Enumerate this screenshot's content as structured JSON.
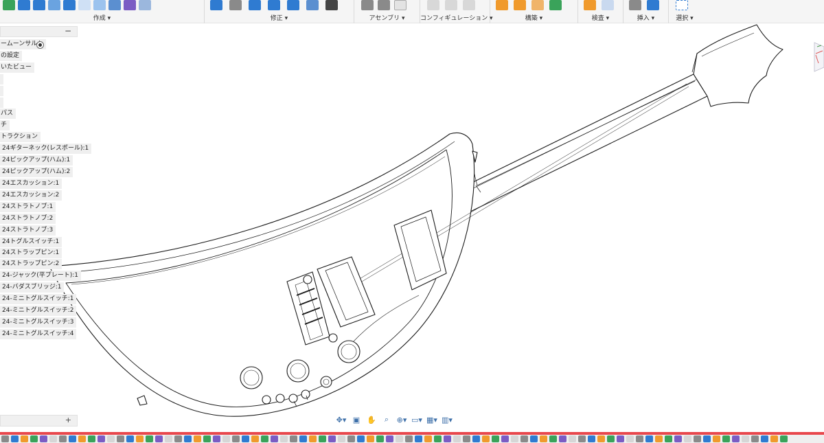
{
  "ribbon": {
    "groups": [
      {
        "label": "作成 ▾",
        "icons": [
          "new-sketch-icon",
          "extrude-icon",
          "box-icon",
          "cylinder-icon",
          "sweep-icon",
          "sketch-line-icon",
          "pattern-icon",
          "cone-icon",
          "add-component-icon",
          "form-icon"
        ]
      },
      {
        "label": "修正 ▾",
        "icons": [
          "press-pull-icon",
          "fillet-icon",
          "shell-icon",
          "combine-icon",
          "split-icon",
          "scale-icon",
          "move-icon"
        ]
      },
      {
        "label": "アセンブリ ▾",
        "icons": [
          "joint-icon",
          "as-built-joint-icon",
          "rigid-group-icon"
        ]
      },
      {
        "label": "コンフィギュレーション ▾",
        "icons": [
          "parameter-table-icon",
          "configure-icon",
          "theme-icon"
        ]
      },
      {
        "label": "構築 ▾",
        "icons": [
          "offset-plane-icon",
          "plane-at-angle-icon",
          "axis-icon",
          "point-icon"
        ]
      },
      {
        "label": "検査 ▾",
        "icons": [
          "measure-icon",
          "section-analysis-icon"
        ]
      },
      {
        "label": "挿入 ▾",
        "icons": [
          "insert-derive-icon",
          "insert-canvas-icon"
        ]
      },
      {
        "label": "選択 ▾",
        "icons": [
          "select-window-icon"
        ]
      }
    ]
  },
  "browser": {
    "items": [
      {
        "label": "ームーンサルト",
        "icon": "radio-icon"
      },
      {
        "label": "の設定"
      },
      {
        "label": "いたビュー"
      },
      {
        "label": ""
      },
      {
        "label": ""
      },
      {
        "label": ""
      },
      {
        "label": "パス"
      },
      {
        "label": "チ"
      },
      {
        "label": "トラクション"
      },
      {
        "label": "24ギターネック(レスポール):1"
      },
      {
        "label": "24ピックアップ(ハム):1"
      },
      {
        "label": "24ピックアップ(ハム):2"
      },
      {
        "label": "24エスカッション:1"
      },
      {
        "label": "24エスカッション:2"
      },
      {
        "label": "24ストラトノブ:1"
      },
      {
        "label": "24ストラトノブ:2"
      },
      {
        "label": "24ストラトノブ:3"
      },
      {
        "label": "24トグルスイッチ:1"
      },
      {
        "label": "24ストラップピン:1"
      },
      {
        "label": "24ストラップピン:2"
      },
      {
        "label": "24-ジャック(平プレート):1"
      },
      {
        "label": "24-バダスブリッジ:1"
      },
      {
        "label": "24-ミニトグルスイッチ:1"
      },
      {
        "label": "24-ミニトグルスイッチ:2"
      },
      {
        "label": "24-ミニトグルスイッチ:3"
      },
      {
        "label": "24-ミニトグルスイッチ:4"
      }
    ],
    "header_toggle": "−",
    "footer_toggle": "+"
  },
  "navbar": {
    "tools": [
      "orbit-icon",
      "look-at-icon",
      "pan-icon",
      "zoom-icon",
      "zoom-window-icon",
      "display-settings-icon",
      "grid-icon",
      "viewports-icon"
    ],
    "glyphs": [
      "✥▾",
      "▣",
      "✋",
      "⌕",
      "⊕▾",
      "▭▾",
      "▦▾",
      "▥▾"
    ]
  },
  "colors": {
    "accent_red": "#e8474c",
    "icon_blue": "#2f7bd1",
    "icon_grey": "#8a8a8a",
    "icon_orange": "#f09a2c",
    "icon_green": "#3aa35a",
    "icon_purple": "#7b5cc4"
  }
}
